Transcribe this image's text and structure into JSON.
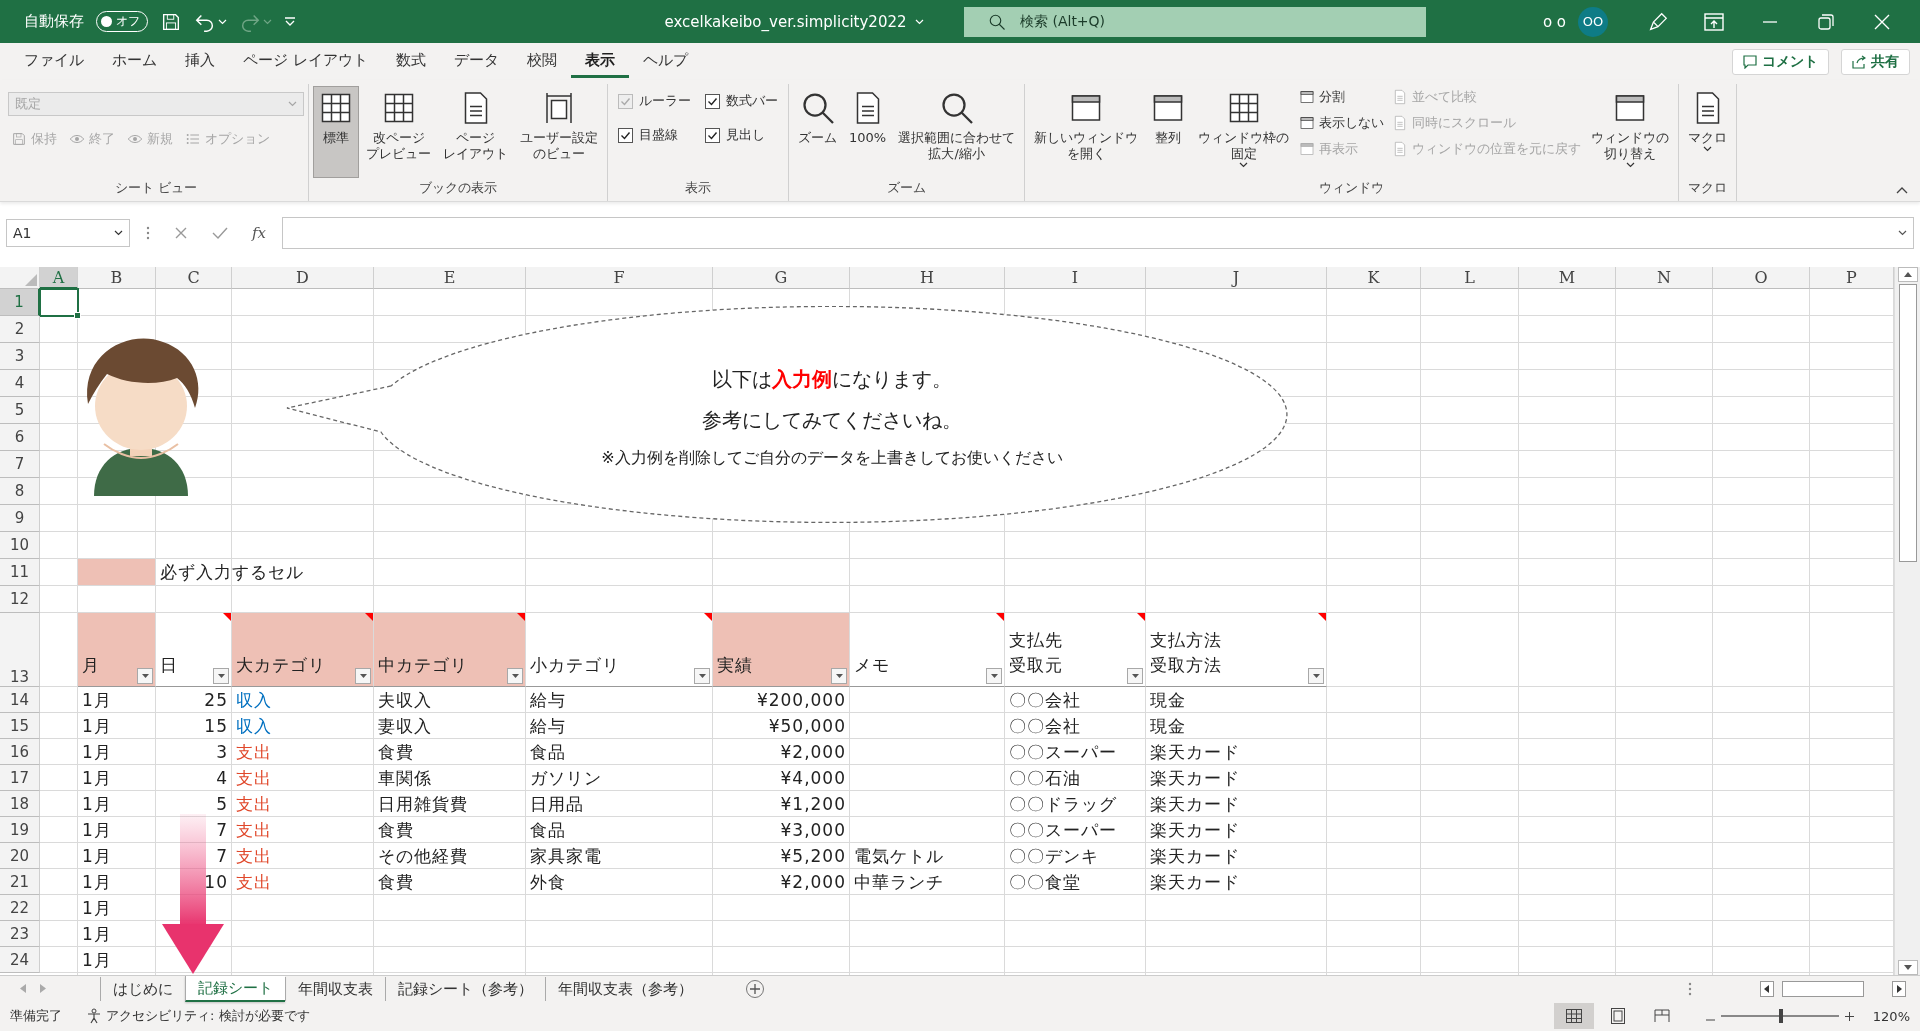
{
  "title_bar": {
    "autosave_label": "自動保存",
    "autosave_toggle": {
      "label": "オフ",
      "on": false
    },
    "undo": {
      "disabled": false
    },
    "redo": {
      "disabled": true
    },
    "document_title": "excelkakeibo_ver.simplicity2022",
    "search": {
      "placeholder": "検索 (Alt+Q)"
    },
    "user_name": "o o",
    "avatar": "OO"
  },
  "menu_tabs": [
    {
      "label": "ファイル",
      "selected": false
    },
    {
      "label": "ホーム",
      "selected": false
    },
    {
      "label": "挿入",
      "selected": false
    },
    {
      "label": "ページ レイアウト",
      "selected": false
    },
    {
      "label": "数式",
      "selected": false
    },
    {
      "label": "データ",
      "selected": false
    },
    {
      "label": "校閲",
      "selected": false
    },
    {
      "label": "表示",
      "selected": true
    },
    {
      "label": "ヘルプ",
      "selected": false
    }
  ],
  "comment_button": "コメント",
  "share_button": "共有",
  "ribbon": {
    "groups": [
      {
        "title": "シート ビュー",
        "columns": [
          [
            {
              "kind": "dropdown",
              "label": "既定",
              "disabled": true
            },
            {
              "kind": "toolbar",
              "items": [
                {
                  "kind": "small",
                  "label": "保持",
                  "disabled": true
                },
                {
                  "kind": "small",
                  "label": "終了",
                  "disabled": true
                },
                {
                  "kind": "small",
                  "label": "新規",
                  "disabled": true
                },
                {
                  "kind": "small",
                  "label": "オプション",
                  "disabled": true
                }
              ]
            }
          ]
        ]
      },
      {
        "title": "ブックの表示",
        "columns": [
          [
            {
              "kind": "large",
              "lines": [
                "標準"
              ],
              "selected": true
            }
          ],
          [
            {
              "kind": "large",
              "lines": [
                "改ページ",
                "プレビュー"
              ],
              "selected": false
            }
          ],
          [
            {
              "kind": "large",
              "lines": [
                "ページ",
                "レイアウト"
              ],
              "selected": false
            }
          ],
          [
            {
              "kind": "large",
              "lines": [
                "ユーザー設定",
                "のビュー"
              ],
              "selected": false
            }
          ]
        ]
      },
      {
        "title": "表示",
        "columns": [
          [
            {
              "kind": "check",
              "label": "ルーラー",
              "checked": true,
              "disabled": true
            },
            {
              "kind": "check",
              "label": "目盛線",
              "checked": true,
              "disabled": false
            }
          ],
          [
            {
              "kind": "check",
              "label": "数式バー",
              "checked": true,
              "disabled": false
            },
            {
              "kind": "check",
              "label": "見出し",
              "checked": true,
              "disabled": false
            }
          ]
        ]
      },
      {
        "title": "ズーム",
        "columns": [
          [
            {
              "kind": "large",
              "lines": [
                "ズーム"
              ]
            }
          ],
          [
            {
              "kind": "large",
              "lines": [
                "100%"
              ]
            }
          ],
          [
            {
              "kind": "large",
              "lines": [
                "選択範囲に合わせて",
                "拡大/縮小"
              ]
            }
          ]
        ]
      },
      {
        "title": "ウィンドウ",
        "columns": [
          [
            {
              "kind": "large",
              "lines": [
                "新しいウィンドウ",
                "を開く"
              ]
            }
          ],
          [
            {
              "kind": "large",
              "lines": [
                "整列"
              ]
            }
          ],
          [
            {
              "kind": "large",
              "lines": [
                "ウィンドウ枠の",
                "固定"
              ],
              "menu": true
            }
          ],
          [
            {
              "kind": "small",
              "label": "分割",
              "disabled": false
            },
            {
              "kind": "small",
              "label": "表示しない",
              "disabled": false
            },
            {
              "kind": "small",
              "label": "再表示",
              "disabled": true
            }
          ],
          [
            {
              "kind": "small",
              "label": "並べて比較",
              "disabled": true
            },
            {
              "kind": "small",
              "label": "同時にスクロール",
              "disabled": true
            },
            {
              "kind": "small",
              "label": "ウィンドウの位置を元に戻す",
              "disabled": true
            }
          ],
          [
            {
              "kind": "large",
              "lines": [
                "ウィンドウの",
                "切り替え"
              ],
              "menu": true
            }
          ]
        ]
      },
      {
        "title": "マクロ",
        "columns": [
          [
            {
              "kind": "large",
              "lines": [
                "マクロ"
              ],
              "menu": true
            }
          ]
        ]
      }
    ]
  },
  "formula_bar": {
    "name_box": "A1",
    "fx": "fx"
  },
  "sheet": {
    "columns": [
      {
        "label": "A",
        "selected": true
      },
      {
        "label": "B",
        "selected": false
      },
      {
        "label": "C",
        "selected": false
      },
      {
        "label": "D",
        "selected": false
      },
      {
        "label": "E",
        "selected": false
      },
      {
        "label": "F",
        "selected": false
      },
      {
        "label": "G",
        "selected": false
      },
      {
        "label": "H",
        "selected": false
      },
      {
        "label": "I",
        "selected": false
      },
      {
        "label": "J",
        "selected": false
      },
      {
        "label": "K",
        "selected": false
      },
      {
        "label": "L",
        "selected": false
      },
      {
        "label": "M",
        "selected": false
      },
      {
        "label": "N",
        "selected": false
      },
      {
        "label": "O",
        "selected": false
      },
      {
        "label": "P",
        "selected": false
      }
    ],
    "row_numbers": [
      {
        "label": "1",
        "selected": true
      },
      {
        "label": "2",
        "selected": false
      },
      {
        "label": "3",
        "selected": false
      },
      {
        "label": "4",
        "selected": false
      },
      {
        "label": "5",
        "selected": false
      },
      {
        "label": "6",
        "selected": false
      },
      {
        "label": "7",
        "selected": false
      },
      {
        "label": "8",
        "selected": false
      },
      {
        "label": "9",
        "selected": false
      },
      {
        "label": "10",
        "selected": false
      },
      {
        "label": "11",
        "selected": false
      },
      {
        "label": "12",
        "selected": false
      },
      {
        "label": "13",
        "selected": false
      },
      {
        "label": "14",
        "selected": false
      },
      {
        "label": "15",
        "selected": false
      },
      {
        "label": "16",
        "selected": false
      },
      {
        "label": "17",
        "selected": false
      },
      {
        "label": "18",
        "selected": false
      },
      {
        "label": "19",
        "selected": false
      },
      {
        "label": "20",
        "selected": false
      },
      {
        "label": "21",
        "selected": false
      },
      {
        "label": "22",
        "selected": false
      },
      {
        "label": "23",
        "selected": false
      },
      {
        "label": "24",
        "selected": false
      }
    ],
    "bubble": {
      "lines": [
        "以下は**入力例**になります。",
        "参考にしてみてくださいね。",
        "※入力例を削除してご自分のデータを上書きしてお使いください"
      ]
    },
    "legend": "必ず入力するセル",
    "headers": [
      {
        "text": "月",
        "required": true,
        "comment": false
      },
      {
        "text": "日",
        "required": false,
        "comment": true
      },
      {
        "text": "大カテゴリ",
        "required": true,
        "comment": true
      },
      {
        "text": "中カテゴリ",
        "required": true,
        "comment": true
      },
      {
        "text": "小カテゴリ",
        "required": false,
        "comment": true
      },
      {
        "text": "実績",
        "required": true,
        "comment": false
      },
      {
        "text": "メモ",
        "required": false,
        "comment": true
      },
      {
        "lines": [
          "支払先",
          "受取元"
        ],
        "required": false,
        "comment": true
      },
      {
        "lines": [
          "支払方法",
          "受取方法"
        ],
        "required": false,
        "comment": true
      }
    ],
    "rows": [
      {
        "month": "1月",
        "day": "25",
        "category": "収入",
        "color": "#0070c0",
        "middle": "夫収入",
        "sub": "給与",
        "amount": "¥200,000",
        "payee": "〇〇会社",
        "method": "現金"
      },
      {
        "month": "1月",
        "day": "15",
        "category": "収入",
        "color": "#0070c0",
        "middle": "妻収入",
        "sub": "給与",
        "amount": "¥50,000",
        "payee": "〇〇会社",
        "method": "現金"
      },
      {
        "month": "1月",
        "day": "3",
        "category": "支出",
        "color": "#e0472a",
        "middle": "食費",
        "sub": "食品",
        "amount": "¥2,000",
        "payee": "〇〇スーパー",
        "method": "楽天カード"
      },
      {
        "month": "1月",
        "day": "4",
        "category": "支出",
        "color": "#e0472a",
        "middle": "車関係",
        "sub": "ガソリン",
        "amount": "¥4,000",
        "payee": "〇〇石油",
        "method": "楽天カード"
      },
      {
        "month": "1月",
        "day": "5",
        "category": "支出",
        "color": "#e0472a",
        "middle": "日用雑貨費",
        "sub": "日用品",
        "amount": "¥1,200",
        "payee": "〇〇ドラッグ",
        "method": "楽天カード"
      },
      {
        "month": "1月",
        "day": "7",
        "category": "支出",
        "color": "#e0472a",
        "middle": "食費",
        "sub": "食品",
        "amount": "¥3,000",
        "payee": "〇〇スーパー",
        "method": "楽天カード"
      },
      {
        "month": "1月",
        "day": "7",
        "category": "支出",
        "color": "#e0472a",
        "middle": "その他経費",
        "sub": "家具家電",
        "amount": "¥5,200",
        "memo": "電気ケトル",
        "payee": "〇〇デンキ",
        "method": "楽天カード"
      },
      {
        "month": "1月",
        "day": "10",
        "category": "支出",
        "color": "#e0472a",
        "middle": "食費",
        "sub": "外食",
        "amount": "¥2,000",
        "memo": "中華ランチ",
        "payee": "〇〇食堂",
        "method": "楽天カード"
      },
      {
        "month": "1月"
      },
      {
        "month": "1月"
      },
      {
        "month": "1月"
      }
    ]
  },
  "sheet_tabs": [
    {
      "label": "はじめに",
      "selected": false
    },
    {
      "label": "記録シート",
      "selected": true
    },
    {
      "label": "年間収支表",
      "selected": false
    },
    {
      "label": "記録シート（参考）",
      "selected": false
    },
    {
      "label": "年間収支表（参考）",
      "selected": false
    }
  ],
  "status_bar": {
    "status": "準備完了",
    "accessibility": "アクセシビリティ: 検討が必要です",
    "view_buttons": [
      {
        "selected": true
      },
      {
        "selected": false
      },
      {
        "selected": false
      }
    ],
    "zoom": {
      "level": 0.51,
      "reading": "120%"
    }
  }
}
